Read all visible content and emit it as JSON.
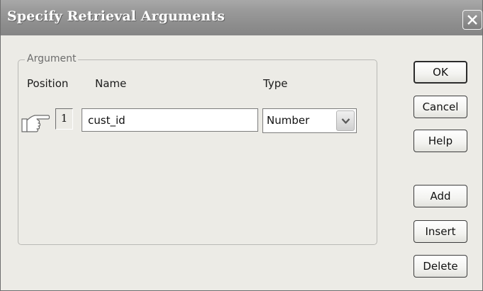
{
  "dialog": {
    "title": "Specify Retrieval Arguments"
  },
  "argument_group": {
    "legend": "Argument",
    "headers": {
      "position": "Position",
      "name": "Name",
      "type": "Type"
    },
    "rows": [
      {
        "position": "1",
        "name": "cust_id",
        "type": "Number"
      }
    ]
  },
  "buttons": {
    "ok": "OK",
    "cancel": "Cancel",
    "help": "Help",
    "add": "Add",
    "insert": "Insert",
    "delete": "Delete"
  },
  "icons": {
    "close": "close-icon",
    "current_row": "pointing-hand-icon",
    "dropdown": "chevron-down-icon"
  }
}
